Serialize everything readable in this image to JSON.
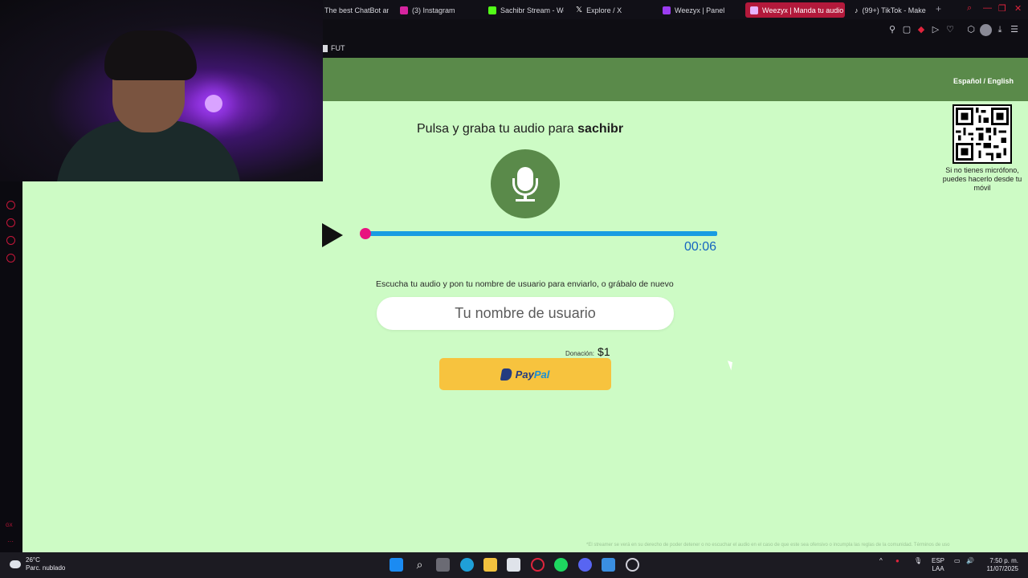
{
  "browser": {
    "tabs": [
      {
        "title": "The best ChatBot an",
        "active": false
      },
      {
        "title": "(3) Instagram",
        "active": false
      },
      {
        "title": "Sachibr Stream - We",
        "active": false
      },
      {
        "title": "Explore / X",
        "active": false
      },
      {
        "title": "Weezyx | Panel",
        "active": false
      },
      {
        "title": "Weezyx | Manda tu audio",
        "active": true
      },
      {
        "title": "(99+) TikTok - Make",
        "active": false
      }
    ],
    "bookmark": "FUT",
    "accent_color": "#b3193b"
  },
  "page": {
    "language_switch": "Español / English",
    "title_prefix": "Pulsa y graba tu audio para ",
    "streamer": "sachibr",
    "player": {
      "time": "00:06",
      "progress": 0.0
    },
    "hint": "Escucha tu audio y pon tu nombre de usuario para enviarlo, o grábalo de nuevo",
    "username_placeholder": "Tu nombre de usuario",
    "donation_label": "Donación:",
    "donation_amount": "$1",
    "paypal_pay": "Pay",
    "paypal_pal": "Pal",
    "qr_caption": "Si no tienes micrófono, puedes hacerlo desde tu móvil",
    "footnote": "*El streamer se verá en su derecho de poder detener o no escuchar el audio en el caso de que este sea ofensivo o incumpla las reglas de la comunidad. Términos de uso",
    "colors": {
      "background": "#cdfbc5",
      "header": "#5a8a4a",
      "progress": "#189ce2",
      "thumb": "#e8137f",
      "paypal": "#f7c33e"
    }
  },
  "taskbar": {
    "weather_temp": "26°C",
    "weather_desc": "Parc. nublado",
    "lang_top": "ESP",
    "lang_bottom": "LAA",
    "time": "7:50 p. m.",
    "date": "11/07/2025"
  }
}
